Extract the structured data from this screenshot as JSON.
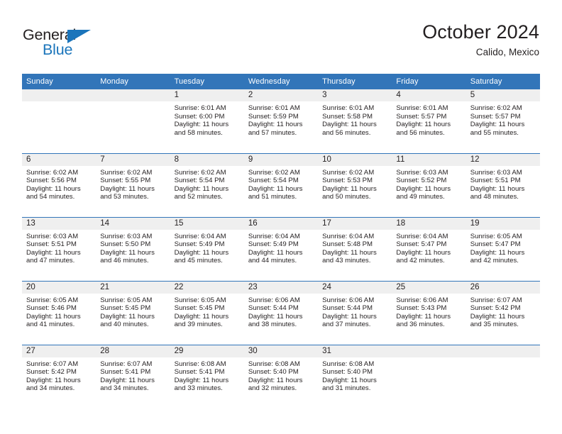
{
  "brand": {
    "name_top": "General",
    "name_bottom": "Blue",
    "accent_color": "#1b75bb",
    "triangle_icon": "triangle-icon"
  },
  "header": {
    "title": "October 2024",
    "subtitle": "Calido, Mexico",
    "header_bg_color": "#3275b9",
    "daynum_band_color": "#efefef"
  },
  "weekday_headers": [
    "Sunday",
    "Monday",
    "Tuesday",
    "Wednesday",
    "Thursday",
    "Friday",
    "Saturday"
  ],
  "weeks": [
    [
      {
        "day": "",
        "sunrise": "",
        "sunset": "",
        "daylight_line1": "",
        "daylight_line2": "",
        "empty": true
      },
      {
        "day": "",
        "sunrise": "",
        "sunset": "",
        "daylight_line1": "",
        "daylight_line2": "",
        "empty": true
      },
      {
        "day": "1",
        "sunrise": "Sunrise: 6:01 AM",
        "sunset": "Sunset: 6:00 PM",
        "daylight_line1": "Daylight: 11 hours",
        "daylight_line2": "and 58 minutes.",
        "empty": false
      },
      {
        "day": "2",
        "sunrise": "Sunrise: 6:01 AM",
        "sunset": "Sunset: 5:59 PM",
        "daylight_line1": "Daylight: 11 hours",
        "daylight_line2": "and 57 minutes.",
        "empty": false
      },
      {
        "day": "3",
        "sunrise": "Sunrise: 6:01 AM",
        "sunset": "Sunset: 5:58 PM",
        "daylight_line1": "Daylight: 11 hours",
        "daylight_line2": "and 56 minutes.",
        "empty": false
      },
      {
        "day": "4",
        "sunrise": "Sunrise: 6:01 AM",
        "sunset": "Sunset: 5:57 PM",
        "daylight_line1": "Daylight: 11 hours",
        "daylight_line2": "and 56 minutes.",
        "empty": false
      },
      {
        "day": "5",
        "sunrise": "Sunrise: 6:02 AM",
        "sunset": "Sunset: 5:57 PM",
        "daylight_line1": "Daylight: 11 hours",
        "daylight_line2": "and 55 minutes.",
        "empty": false
      }
    ],
    [
      {
        "day": "6",
        "sunrise": "Sunrise: 6:02 AM",
        "sunset": "Sunset: 5:56 PM",
        "daylight_line1": "Daylight: 11 hours",
        "daylight_line2": "and 54 minutes.",
        "empty": false
      },
      {
        "day": "7",
        "sunrise": "Sunrise: 6:02 AM",
        "sunset": "Sunset: 5:55 PM",
        "daylight_line1": "Daylight: 11 hours",
        "daylight_line2": "and 53 minutes.",
        "empty": false
      },
      {
        "day": "8",
        "sunrise": "Sunrise: 6:02 AM",
        "sunset": "Sunset: 5:54 PM",
        "daylight_line1": "Daylight: 11 hours",
        "daylight_line2": "and 52 minutes.",
        "empty": false
      },
      {
        "day": "9",
        "sunrise": "Sunrise: 6:02 AM",
        "sunset": "Sunset: 5:54 PM",
        "daylight_line1": "Daylight: 11 hours",
        "daylight_line2": "and 51 minutes.",
        "empty": false
      },
      {
        "day": "10",
        "sunrise": "Sunrise: 6:02 AM",
        "sunset": "Sunset: 5:53 PM",
        "daylight_line1": "Daylight: 11 hours",
        "daylight_line2": "and 50 minutes.",
        "empty": false
      },
      {
        "day": "11",
        "sunrise": "Sunrise: 6:03 AM",
        "sunset": "Sunset: 5:52 PM",
        "daylight_line1": "Daylight: 11 hours",
        "daylight_line2": "and 49 minutes.",
        "empty": false
      },
      {
        "day": "12",
        "sunrise": "Sunrise: 6:03 AM",
        "sunset": "Sunset: 5:51 PM",
        "daylight_line1": "Daylight: 11 hours",
        "daylight_line2": "and 48 minutes.",
        "empty": false
      }
    ],
    [
      {
        "day": "13",
        "sunrise": "Sunrise: 6:03 AM",
        "sunset": "Sunset: 5:51 PM",
        "daylight_line1": "Daylight: 11 hours",
        "daylight_line2": "and 47 minutes.",
        "empty": false
      },
      {
        "day": "14",
        "sunrise": "Sunrise: 6:03 AM",
        "sunset": "Sunset: 5:50 PM",
        "daylight_line1": "Daylight: 11 hours",
        "daylight_line2": "and 46 minutes.",
        "empty": false
      },
      {
        "day": "15",
        "sunrise": "Sunrise: 6:04 AM",
        "sunset": "Sunset: 5:49 PM",
        "daylight_line1": "Daylight: 11 hours",
        "daylight_line2": "and 45 minutes.",
        "empty": false
      },
      {
        "day": "16",
        "sunrise": "Sunrise: 6:04 AM",
        "sunset": "Sunset: 5:49 PM",
        "daylight_line1": "Daylight: 11 hours",
        "daylight_line2": "and 44 minutes.",
        "empty": false
      },
      {
        "day": "17",
        "sunrise": "Sunrise: 6:04 AM",
        "sunset": "Sunset: 5:48 PM",
        "daylight_line1": "Daylight: 11 hours",
        "daylight_line2": "and 43 minutes.",
        "empty": false
      },
      {
        "day": "18",
        "sunrise": "Sunrise: 6:04 AM",
        "sunset": "Sunset: 5:47 PM",
        "daylight_line1": "Daylight: 11 hours",
        "daylight_line2": "and 42 minutes.",
        "empty": false
      },
      {
        "day": "19",
        "sunrise": "Sunrise: 6:05 AM",
        "sunset": "Sunset: 5:47 PM",
        "daylight_line1": "Daylight: 11 hours",
        "daylight_line2": "and 42 minutes.",
        "empty": false
      }
    ],
    [
      {
        "day": "20",
        "sunrise": "Sunrise: 6:05 AM",
        "sunset": "Sunset: 5:46 PM",
        "daylight_line1": "Daylight: 11 hours",
        "daylight_line2": "and 41 minutes.",
        "empty": false
      },
      {
        "day": "21",
        "sunrise": "Sunrise: 6:05 AM",
        "sunset": "Sunset: 5:45 PM",
        "daylight_line1": "Daylight: 11 hours",
        "daylight_line2": "and 40 minutes.",
        "empty": false
      },
      {
        "day": "22",
        "sunrise": "Sunrise: 6:05 AM",
        "sunset": "Sunset: 5:45 PM",
        "daylight_line1": "Daylight: 11 hours",
        "daylight_line2": "and 39 minutes.",
        "empty": false
      },
      {
        "day": "23",
        "sunrise": "Sunrise: 6:06 AM",
        "sunset": "Sunset: 5:44 PM",
        "daylight_line1": "Daylight: 11 hours",
        "daylight_line2": "and 38 minutes.",
        "empty": false
      },
      {
        "day": "24",
        "sunrise": "Sunrise: 6:06 AM",
        "sunset": "Sunset: 5:44 PM",
        "daylight_line1": "Daylight: 11 hours",
        "daylight_line2": "and 37 minutes.",
        "empty": false
      },
      {
        "day": "25",
        "sunrise": "Sunrise: 6:06 AM",
        "sunset": "Sunset: 5:43 PM",
        "daylight_line1": "Daylight: 11 hours",
        "daylight_line2": "and 36 minutes.",
        "empty": false
      },
      {
        "day": "26",
        "sunrise": "Sunrise: 6:07 AM",
        "sunset": "Sunset: 5:42 PM",
        "daylight_line1": "Daylight: 11 hours",
        "daylight_line2": "and 35 minutes.",
        "empty": false
      }
    ],
    [
      {
        "day": "27",
        "sunrise": "Sunrise: 6:07 AM",
        "sunset": "Sunset: 5:42 PM",
        "daylight_line1": "Daylight: 11 hours",
        "daylight_line2": "and 34 minutes.",
        "empty": false
      },
      {
        "day": "28",
        "sunrise": "Sunrise: 6:07 AM",
        "sunset": "Sunset: 5:41 PM",
        "daylight_line1": "Daylight: 11 hours",
        "daylight_line2": "and 34 minutes.",
        "empty": false
      },
      {
        "day": "29",
        "sunrise": "Sunrise: 6:08 AM",
        "sunset": "Sunset: 5:41 PM",
        "daylight_line1": "Daylight: 11 hours",
        "daylight_line2": "and 33 minutes.",
        "empty": false
      },
      {
        "day": "30",
        "sunrise": "Sunrise: 6:08 AM",
        "sunset": "Sunset: 5:40 PM",
        "daylight_line1": "Daylight: 11 hours",
        "daylight_line2": "and 32 minutes.",
        "empty": false
      },
      {
        "day": "31",
        "sunrise": "Sunrise: 6:08 AM",
        "sunset": "Sunset: 5:40 PM",
        "daylight_line1": "Daylight: 11 hours",
        "daylight_line2": "and 31 minutes.",
        "empty": false
      },
      {
        "day": "",
        "sunrise": "",
        "sunset": "",
        "daylight_line1": "",
        "daylight_line2": "",
        "empty": true
      },
      {
        "day": "",
        "sunrise": "",
        "sunset": "",
        "daylight_line1": "",
        "daylight_line2": "",
        "empty": true
      }
    ]
  ]
}
